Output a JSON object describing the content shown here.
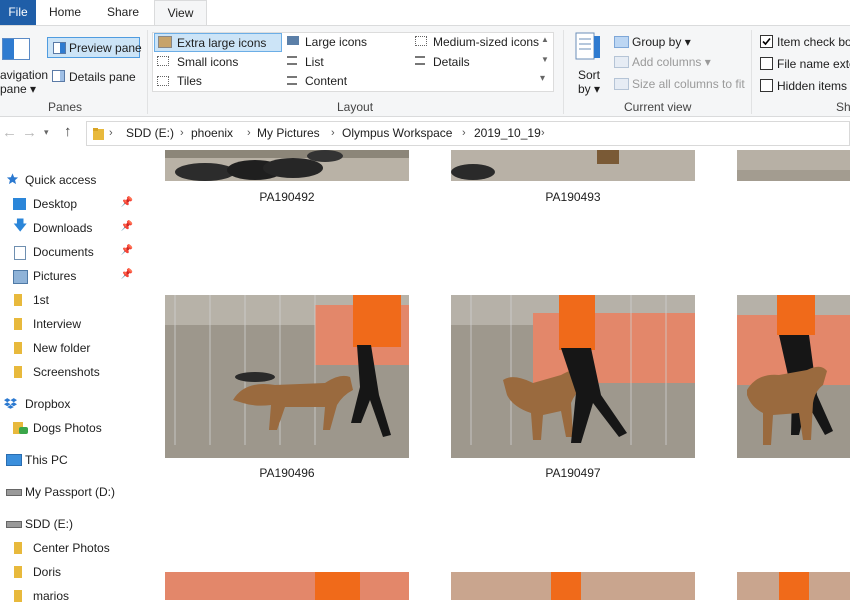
{
  "tabs": [
    "File",
    "Home",
    "Share",
    "View"
  ],
  "ribbon": {
    "panes": {
      "nav_pane": [
        "avigation",
        "pane ▾"
      ],
      "preview_pane": "Preview pane",
      "details_pane": "Details pane",
      "group_label": "Panes"
    },
    "layout": {
      "options": [
        "Extra large icons",
        "Large icons",
        "Medium-sized icons",
        "Small icons",
        "List",
        "Details",
        "Tiles",
        "Content"
      ],
      "selected": "Extra large icons",
      "group_label": "Layout"
    },
    "current_view": {
      "sort_by": [
        "Sort",
        "by ▾"
      ],
      "group_by": "Group by ▾",
      "add_columns": "Add columns ▾",
      "size_columns": "Size all columns to fit",
      "group_label": "Current view"
    },
    "show_hide": {
      "item_check_boxes": "Item check box",
      "file_name_ext": "File name exte",
      "hidden_items": "Hidden items",
      "group_label": "Sh"
    }
  },
  "address": {
    "crumbs": [
      "SDD (E:)",
      "phoenix",
      "My Pictures",
      "Olympus Workspace",
      "2019_10_19"
    ]
  },
  "nav": {
    "quick_access": "Quick access",
    "pinned": [
      "Desktop",
      "Downloads",
      "Documents",
      "Pictures"
    ],
    "folders": [
      "1st",
      "Interview",
      "New folder",
      "Screenshots"
    ],
    "dropbox": "Dropbox",
    "dogs_photos": "Dogs Photos",
    "this_pc": "This PC",
    "my_passport": "My Passport (D:)",
    "sdd": "SDD (E:)",
    "sdd_folders": [
      "Center Photos",
      "Doris",
      "marios"
    ]
  },
  "files": {
    "row1": [
      "PA190492",
      "PA190493",
      "PA"
    ],
    "row2": [
      "PA190496",
      "PA190497",
      "PA"
    ]
  },
  "colors": {
    "accent": "#1f5ea8",
    "selected_bg": "#cce4f7",
    "folder": "#e8b93c",
    "shirt": "#f06a1a",
    "wall": "#e3876a",
    "gravel": "#9a958c",
    "dog": "#9a6a3e"
  }
}
